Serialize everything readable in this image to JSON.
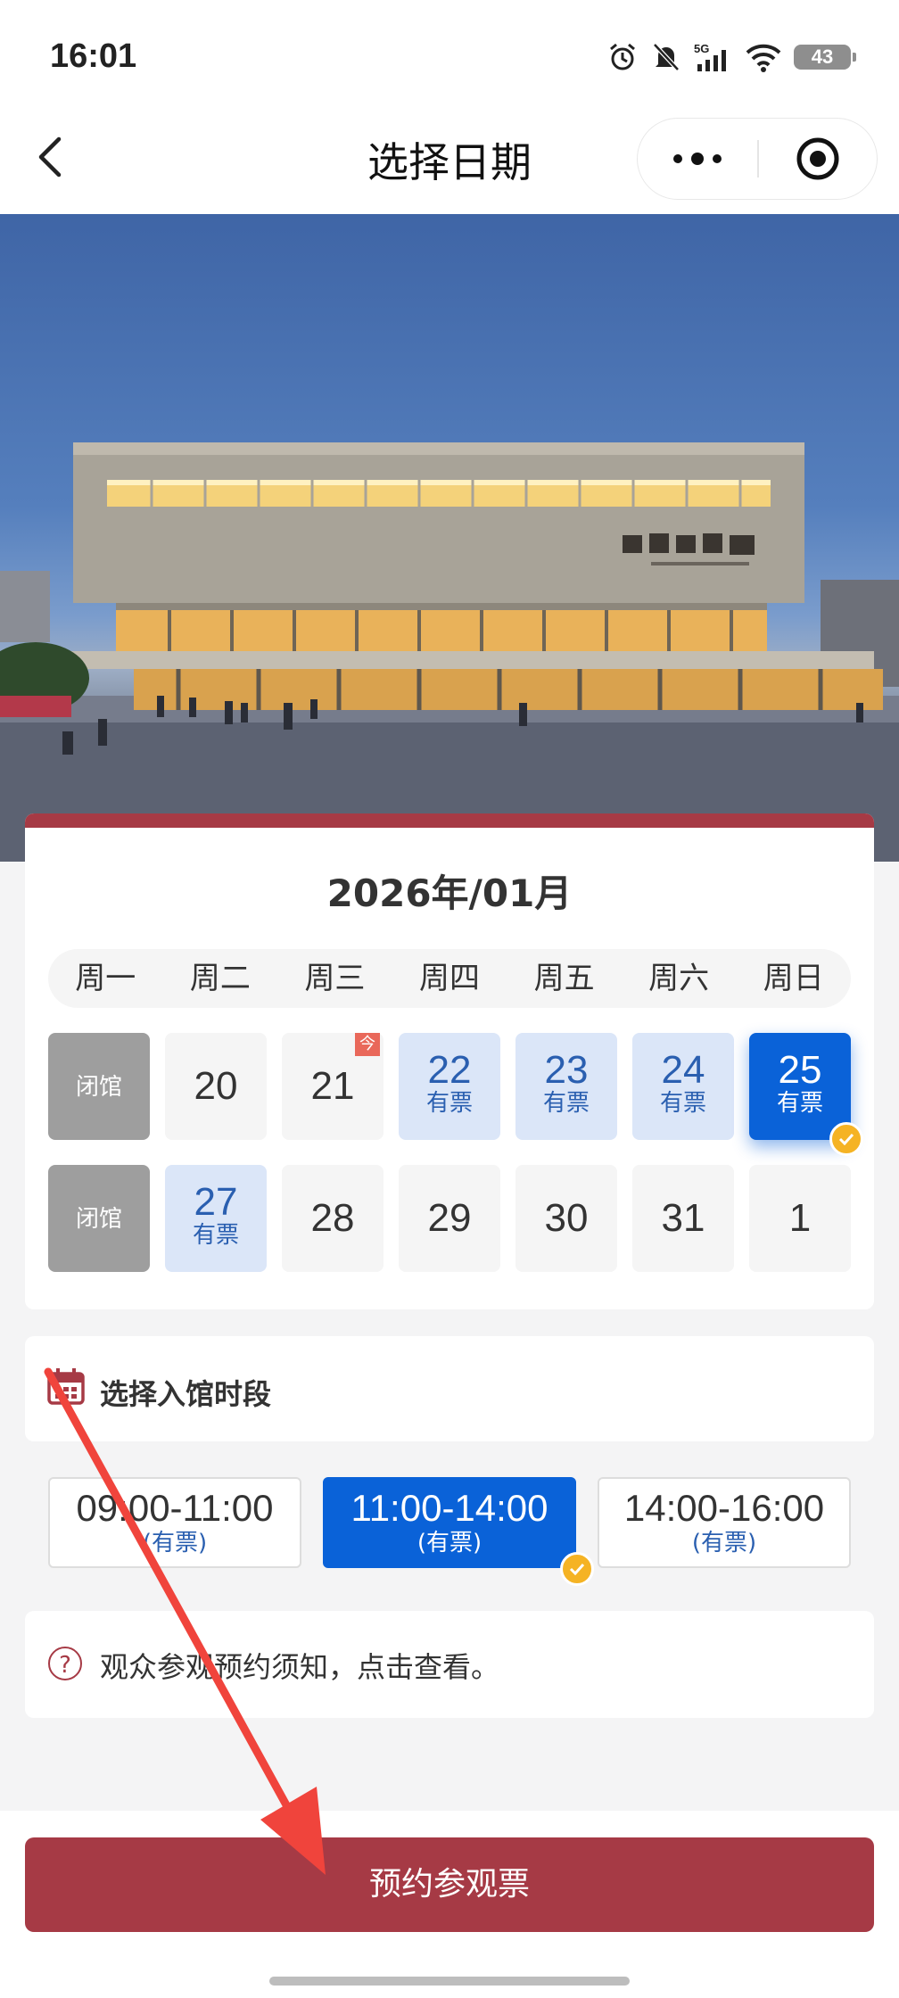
{
  "status_bar": {
    "time": "16:01",
    "battery": "43"
  },
  "nav": {
    "title": "选择日期"
  },
  "calendar": {
    "month_title": "2026年/01月",
    "weekdays": [
      "周一",
      "周二",
      "周三",
      "周四",
      "周五",
      "周六",
      "周日"
    ],
    "rows": [
      [
        {
          "label": "闭馆",
          "sub": "",
          "state": "closed"
        },
        {
          "label": "20",
          "sub": "",
          "state": "normal"
        },
        {
          "label": "21",
          "sub": "",
          "state": "today",
          "badge": "今"
        },
        {
          "label": "22",
          "sub": "有票",
          "state": "available"
        },
        {
          "label": "23",
          "sub": "有票",
          "state": "available"
        },
        {
          "label": "24",
          "sub": "有票",
          "state": "available"
        },
        {
          "label": "25",
          "sub": "有票",
          "state": "selected"
        }
      ],
      [
        {
          "label": "闭馆",
          "sub": "",
          "state": "closed"
        },
        {
          "label": "27",
          "sub": "有票",
          "state": "available"
        },
        {
          "label": "28",
          "sub": "",
          "state": "normal"
        },
        {
          "label": "29",
          "sub": "",
          "state": "normal"
        },
        {
          "label": "30",
          "sub": "",
          "state": "normal"
        },
        {
          "label": "31",
          "sub": "",
          "state": "normal"
        },
        {
          "label": "1",
          "sub": "",
          "state": "normal"
        }
      ]
    ]
  },
  "time_slots": {
    "title": "选择入馆时段",
    "slots": [
      {
        "time": "09:00-11:00",
        "status": "(有票)",
        "selected": false
      },
      {
        "time": "11:00-14:00",
        "status": "(有票)",
        "selected": true
      },
      {
        "time": "14:00-16:00",
        "status": "(有票)",
        "selected": false
      }
    ]
  },
  "notice": {
    "text": "观众参观预约须知，点击查看。"
  },
  "action": {
    "book_label": "预约参观票"
  },
  "colors": {
    "brand": "#a63a45",
    "selected": "#0a62d8",
    "available_bg": "#dbe6f8",
    "check": "#f5b324"
  }
}
